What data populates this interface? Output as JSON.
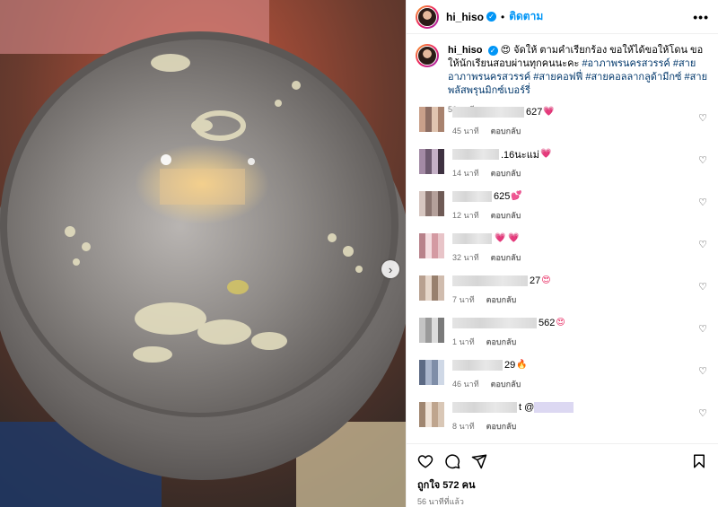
{
  "post": {
    "username": "hi_hiso",
    "follow_label": "ติดตาม",
    "more_label": "•••",
    "caption_text": "😍 จัดให้ ตามคำเรียกร้อง ขอให้ได้ขอให้โดน ขอให้นักเรียนสอบผ่านทุกคนนะคะ",
    "hashtags": "#อาภาพรนครสวรรค์ #สายอาภาพรนครสวรรค์ #สายคอฟฟี่ #สายคอลลากลูด้ามีกซ์ #สายพลัสพรุนมิกซ์เบอร์รี่",
    "caption_time": "56 นาที",
    "likes": "ถูกใจ 572 คน",
    "post_time": "56 นาทีที่แล้ว"
  },
  "reply_label": "ตอบกลับ",
  "comments": [
    {
      "text": "627",
      "emoji": "💗",
      "time": "45 นาที",
      "blur_w": 80
    },
    {
      "text": ".16นะแม่",
      "emoji": "💗",
      "time": "14 นาที",
      "blur_w": 52
    },
    {
      "text": "625",
      "emoji": "💕",
      "time": "12 นาที",
      "blur_w": 44
    },
    {
      "text": "",
      "emoji": "💗 💗",
      "time": "32 นาที",
      "blur_w": 44
    },
    {
      "text": "27",
      "emoji": "😍",
      "time": "7 นาที",
      "blur_w": 84
    },
    {
      "text": "562",
      "emoji": "😍",
      "time": "1 นาที",
      "blur_w": 94
    },
    {
      "text": "29",
      "emoji": "🔥",
      "time": "46 นาที",
      "blur_w": 56
    },
    {
      "text": "t @",
      "emoji": "",
      "time": "8 นาที",
      "blur_w": 72
    }
  ],
  "icons": {
    "heart": "heart-icon",
    "comment": "comment-icon",
    "share": "share-icon",
    "bookmark": "bookmark-icon",
    "next": "chevron-right-icon"
  },
  "colors": {
    "accent": "#0095f6",
    "heart": "#e8265f",
    "muted": "#737373"
  }
}
